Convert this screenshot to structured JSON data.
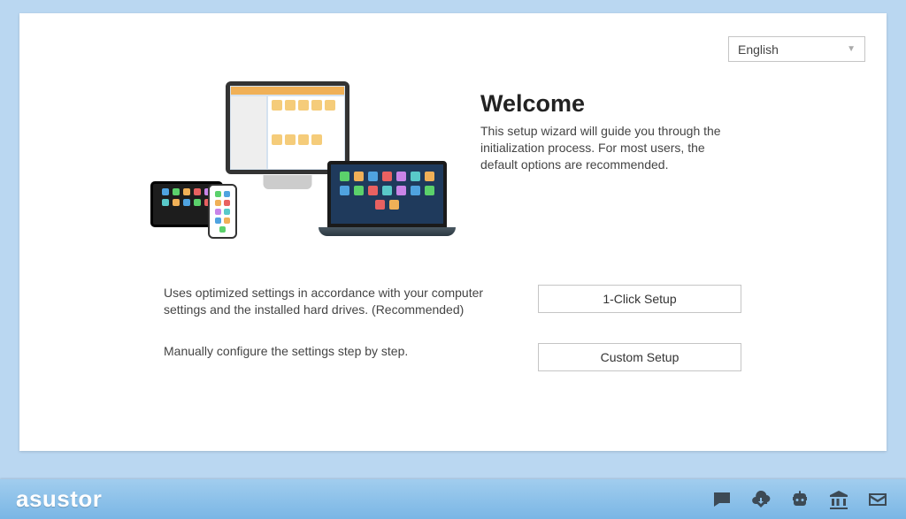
{
  "language": {
    "selected": "English"
  },
  "welcome": {
    "title": "Welcome",
    "body": "This setup wizard will guide you through the initialization process. For most users, the default options are recommended."
  },
  "options": {
    "oneClick": {
      "desc": "Uses optimized settings in accordance with your computer settings and the installed hard drives. (Recommended)",
      "button": "1-Click Setup"
    },
    "custom": {
      "desc": "Manually configure the settings step by step.",
      "button": "Custom Setup"
    }
  },
  "footer": {
    "brand": "asustor"
  }
}
